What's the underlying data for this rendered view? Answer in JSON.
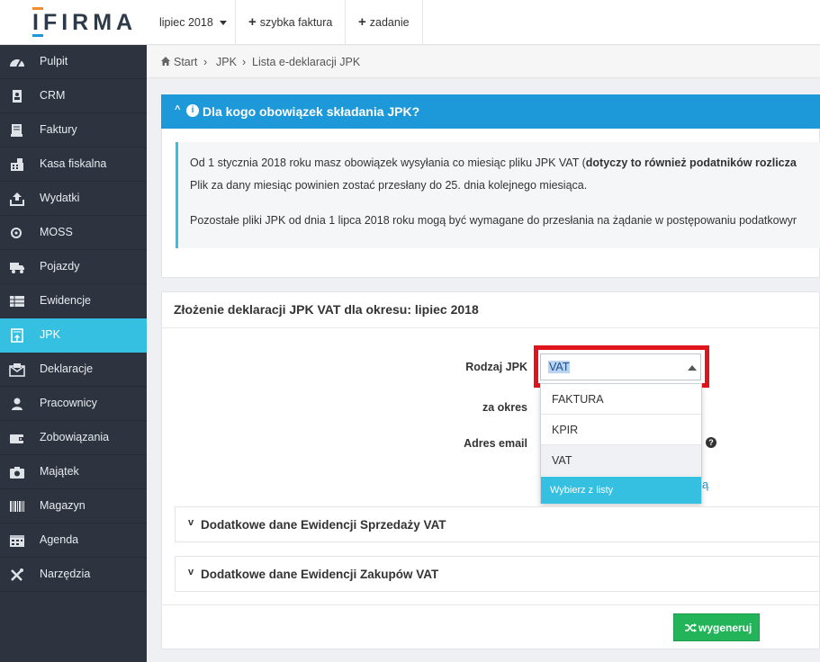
{
  "app": {
    "logo": "IFIRMA"
  },
  "topbar": {
    "period_label": "lipiec 2018",
    "quick_invoice_label": "szybka faktura",
    "task_label": "zadanie"
  },
  "sidebar": {
    "items": [
      {
        "label": "Pulpit",
        "icon": "dashboard-icon"
      },
      {
        "label": "CRM",
        "icon": "address-book-icon"
      },
      {
        "label": "Faktury",
        "icon": "invoice-icon"
      },
      {
        "label": "Kasa fiskalna",
        "icon": "cash-register-icon"
      },
      {
        "label": "Wydatki",
        "icon": "upload-icon"
      },
      {
        "label": "MOSS",
        "icon": "moss-icon"
      },
      {
        "label": "Pojazdy",
        "icon": "truck-icon"
      },
      {
        "label": "Ewidencje",
        "icon": "ledger-icon"
      },
      {
        "label": "JPK",
        "icon": "jpk-icon"
      },
      {
        "label": "Deklaracje",
        "icon": "envelope-icon"
      },
      {
        "label": "Pracownicy",
        "icon": "user-icon"
      },
      {
        "label": "Zobowiązania",
        "icon": "wallet-icon"
      },
      {
        "label": "Majątek",
        "icon": "camera-icon"
      },
      {
        "label": "Magazyn",
        "icon": "barcode-icon"
      },
      {
        "label": "Agenda",
        "icon": "calendar-icon"
      },
      {
        "label": "Narzędzia",
        "icon": "tools-icon"
      }
    ],
    "active": "JPK"
  },
  "breadcrumb": {
    "start": "Start",
    "jpk": "JPK",
    "current": "Lista e-deklaracji JPK"
  },
  "info": {
    "title": "Dla kogo obowiązek składania JPK?",
    "line1_normal": "Od 1 stycznia 2018 roku masz obowiązek wysyłania co miesiąc pliku JPK VAT (",
    "line1_bold": "dotyczy to również podatników rozlicza",
    "line2": "Plik za dany miesiąc powinien zostać przesłany do 25. dnia kolejnego miesiąca.",
    "line3": "Pozostałe pliki JPK od dnia 1 lipca 2018 roku mogą być wymagane do przesłania na żądanie w postępowaniu podatkowyr"
  },
  "form": {
    "title": "Złożenie deklaracji JPK VAT dla okresu: lipiec 2018",
    "rodzaj_label": "Rodzaj JPK",
    "rodzaj_value": "VAT",
    "okres_label": "za okres",
    "email_label": "Adres email",
    "email_help": "?",
    "partial_link": "ą",
    "dropdown_options": [
      "FAKTURA",
      "KPIR",
      "VAT"
    ],
    "dropdown_footer": "Wybierz z listy",
    "sales_section": "Dodatkowe dane Ewidencji Sprzedaży VAT",
    "purchase_section": "Dodatkowe dane Ewidencji Zakupów VAT",
    "generate_label": "wygeneruj"
  },
  "colors": {
    "sidebar_bg": "#2d3440",
    "active": "#35bfe0",
    "info_header": "#1d98d8",
    "generate": "#23b45a",
    "highlight": "#e0141b"
  }
}
